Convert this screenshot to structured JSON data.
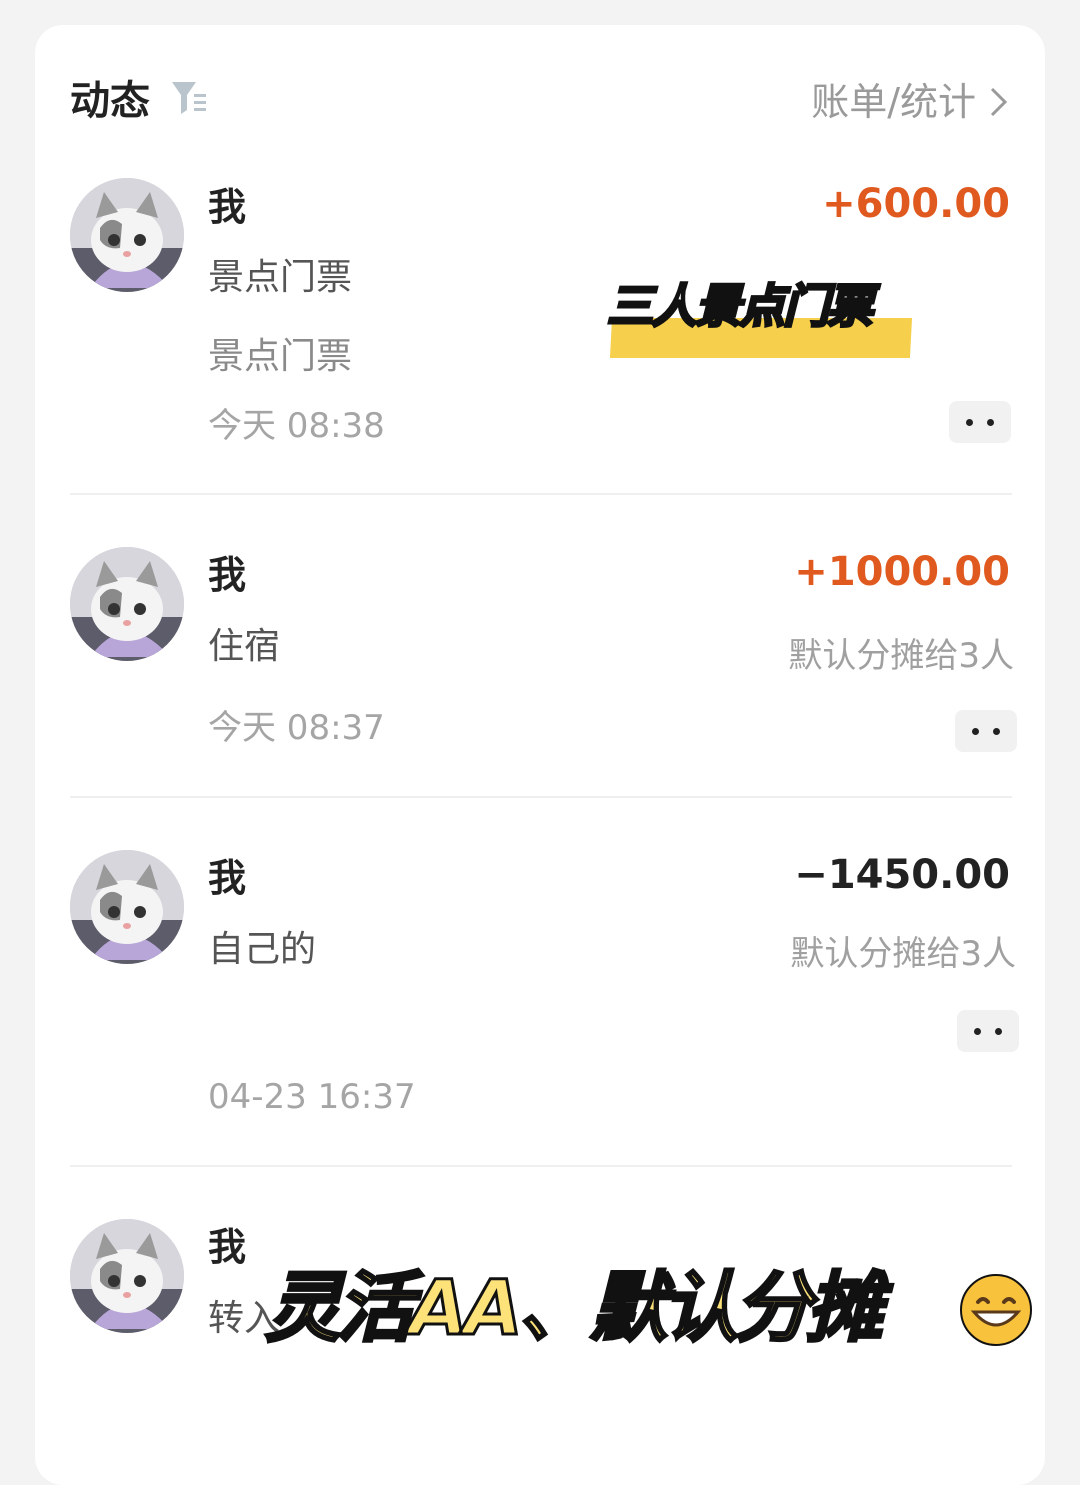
{
  "header": {
    "title": "动态",
    "filter_icon": "filter-list-icon",
    "bill_link": "账单/统计",
    "chevron_icon": "chevron-right-icon"
  },
  "items": [
    {
      "user": "我",
      "amount": "+600.00",
      "amount_color": "#e05a1f",
      "category": "景点门票",
      "note": "景点门票",
      "time": "今天 08:38"
    },
    {
      "user": "我",
      "amount": "+1000.00",
      "amount_color": "#e05a1f",
      "category": "住宿",
      "split": "默认分摊给3人",
      "time": "今天 08:37"
    },
    {
      "user": "我",
      "amount": "−1450.00",
      "amount_color": "#222222",
      "category": "自己的",
      "split": "默认分摊给3人",
      "time": "04-23 16:37"
    },
    {
      "user": "我",
      "category": "转入"
    }
  ],
  "overlays": {
    "sticker_text": "三人景点门票",
    "caption": "灵活AA、默认分摊",
    "emoji_icon": "grinning-face-emoji-icon"
  },
  "colors": {
    "accent_orange": "#e05a1f",
    "highlight_yellow": "#f6d04d"
  }
}
